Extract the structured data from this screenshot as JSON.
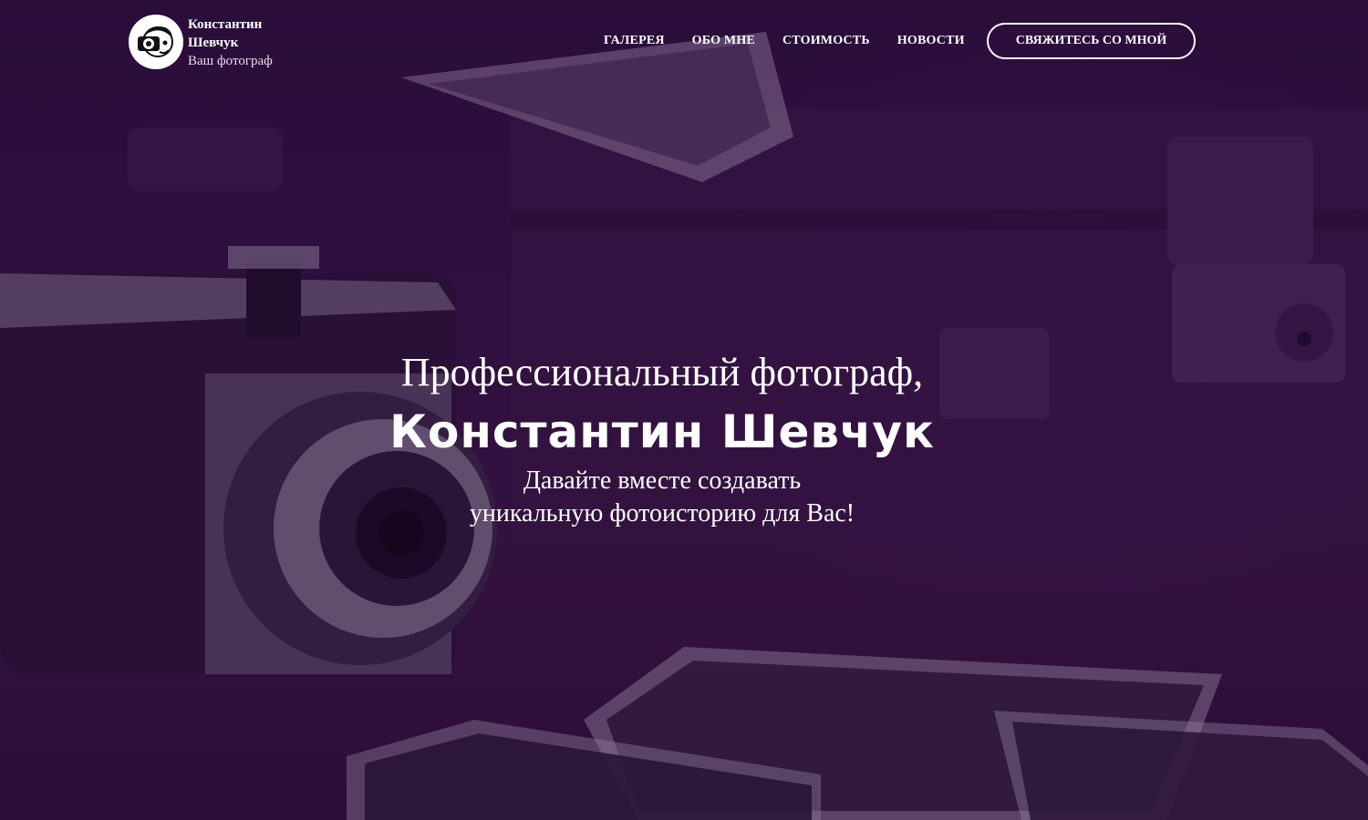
{
  "brand": {
    "name": "Константин Шевчук",
    "tagline": "Ваш фотограф",
    "logo_icon": "photographer-avatar-icon"
  },
  "nav": {
    "items": [
      {
        "label": "ГАЛЕРЕЯ"
      },
      {
        "label": "ОБО МНЕ"
      },
      {
        "label": "СТОИМОСТЬ"
      },
      {
        "label": "НОВОСТИ"
      }
    ],
    "cta_label": "СВЯЖИТЕСЬ СО МНОЙ"
  },
  "hero": {
    "line1": "Профессиональный фотограф,",
    "line2": "Константин Шевчук",
    "sub_line1": "Давайте вместе создавать",
    "sub_line2": "уникальную фотоисторию для Вас!",
    "background": "vintage-camera-photos-suitcase-image"
  },
  "colors": {
    "overlay": "#2a0f3c",
    "text": "#ffffff"
  }
}
